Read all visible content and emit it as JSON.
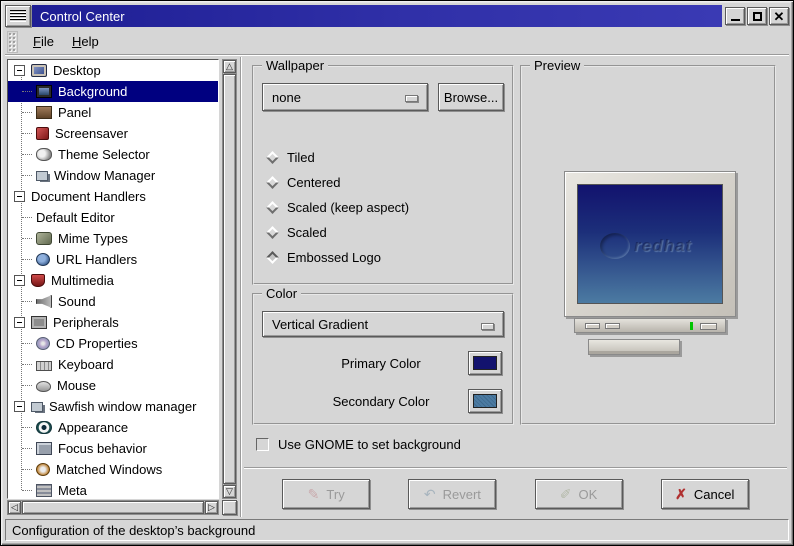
{
  "window": {
    "title": "Control Center",
    "controls": [
      {
        "name": "minimize"
      },
      {
        "name": "maximize"
      },
      {
        "name": "close"
      }
    ]
  },
  "menu": {
    "items": [
      {
        "label": "File"
      },
      {
        "label": "Help"
      }
    ]
  },
  "tree": {
    "items": [
      {
        "label": "Desktop",
        "icon": "desktop",
        "level": 0,
        "expander": true,
        "selected": false
      },
      {
        "label": "Background",
        "icon": "background",
        "level": 1,
        "expander": false,
        "selected": true
      },
      {
        "label": "Panel",
        "icon": "panel",
        "level": 1,
        "expander": false,
        "selected": false
      },
      {
        "label": "Screensaver",
        "icon": "screensaver",
        "level": 1,
        "expander": false,
        "selected": false
      },
      {
        "label": "Theme Selector",
        "icon": "theme-selector",
        "level": 1,
        "expander": false,
        "selected": false
      },
      {
        "label": "Window Manager",
        "icon": "window-manager",
        "level": 1,
        "expander": false,
        "selected": false
      },
      {
        "label": "Document Handlers",
        "icon": "none",
        "level": 0,
        "expander": true,
        "selected": false
      },
      {
        "label": "Default Editor",
        "icon": "none",
        "level": 1,
        "expander": false,
        "selected": false
      },
      {
        "label": "Mime Types",
        "icon": "mime-types",
        "level": 1,
        "expander": false,
        "selected": false
      },
      {
        "label": "URL Handlers",
        "icon": "url-handlers",
        "level": 1,
        "expander": false,
        "selected": false
      },
      {
        "label": "Multimedia",
        "icon": "multimedia",
        "level": 0,
        "expander": true,
        "selected": false
      },
      {
        "label": "Sound",
        "icon": "sound",
        "level": 1,
        "expander": false,
        "selected": false
      },
      {
        "label": "Peripherals",
        "icon": "peripherals",
        "level": 0,
        "expander": true,
        "selected": false
      },
      {
        "label": "CD Properties",
        "icon": "cd-properties",
        "level": 1,
        "expander": false,
        "selected": false
      },
      {
        "label": "Keyboard",
        "icon": "keyboard",
        "level": 1,
        "expander": false,
        "selected": false
      },
      {
        "label": "Mouse",
        "icon": "mouse",
        "level": 1,
        "expander": false,
        "selected": false
      },
      {
        "label": "Sawfish window manager",
        "icon": "sawfish",
        "level": 0,
        "expander": true,
        "selected": false
      },
      {
        "label": "Appearance",
        "icon": "appearance",
        "level": 1,
        "expander": false,
        "selected": false
      },
      {
        "label": "Focus behavior",
        "icon": "focus-behavior",
        "level": 1,
        "expander": false,
        "selected": false
      },
      {
        "label": "Matched Windows",
        "icon": "matched-windows",
        "level": 1,
        "expander": false,
        "selected": false
      },
      {
        "label": "Meta",
        "icon": "meta",
        "level": 1,
        "expander": false,
        "selected": false
      }
    ]
  },
  "scrollbar": {
    "up": "△",
    "down": "▽",
    "left": "◁",
    "right": "▷"
  },
  "wallpaper": {
    "legend": "Wallpaper",
    "file_value": "none",
    "browse_label": "Browse...",
    "modes": [
      {
        "label": "Tiled",
        "selected": false
      },
      {
        "label": "Centered",
        "selected": false
      },
      {
        "label": "Scaled (keep aspect)",
        "selected": false
      },
      {
        "label": "Scaled",
        "selected": false
      },
      {
        "label": "Embossed Logo",
        "selected": true
      }
    ]
  },
  "color": {
    "legend": "Color",
    "gradient_value": "Vertical Gradient",
    "primary_label": "Primary Color",
    "primary_hex": "#12126e",
    "secondary_label": "Secondary Color",
    "secondary_hex": "#4c7ba2"
  },
  "preview": {
    "legend": "Preview",
    "logo_text": "redhat",
    "led_hex": "#00c400"
  },
  "gnome_option": {
    "label": "Use GNOME to set background",
    "checked": false
  },
  "actions": [
    {
      "name": "try",
      "label": "Try",
      "glyph": "✎",
      "glyph_color": "#c29296",
      "enabled": false
    },
    {
      "name": "revert",
      "label": "Revert",
      "glyph": "↶",
      "glyph_color": "#8fa3b2",
      "enabled": false
    },
    {
      "name": "ok",
      "label": "OK",
      "glyph": "✐",
      "glyph_color": "#a3ab93",
      "enabled": false
    },
    {
      "name": "cancel",
      "label": "Cancel",
      "glyph": "✗",
      "glyph_color": "#b03030",
      "enabled": true
    }
  ],
  "statusbar": {
    "text": "Configuration of the desktop’s background"
  },
  "colors": {
    "selection": "#000080",
    "titlebar": "#2b2ba4",
    "base_grey": "#d6d6d6"
  }
}
